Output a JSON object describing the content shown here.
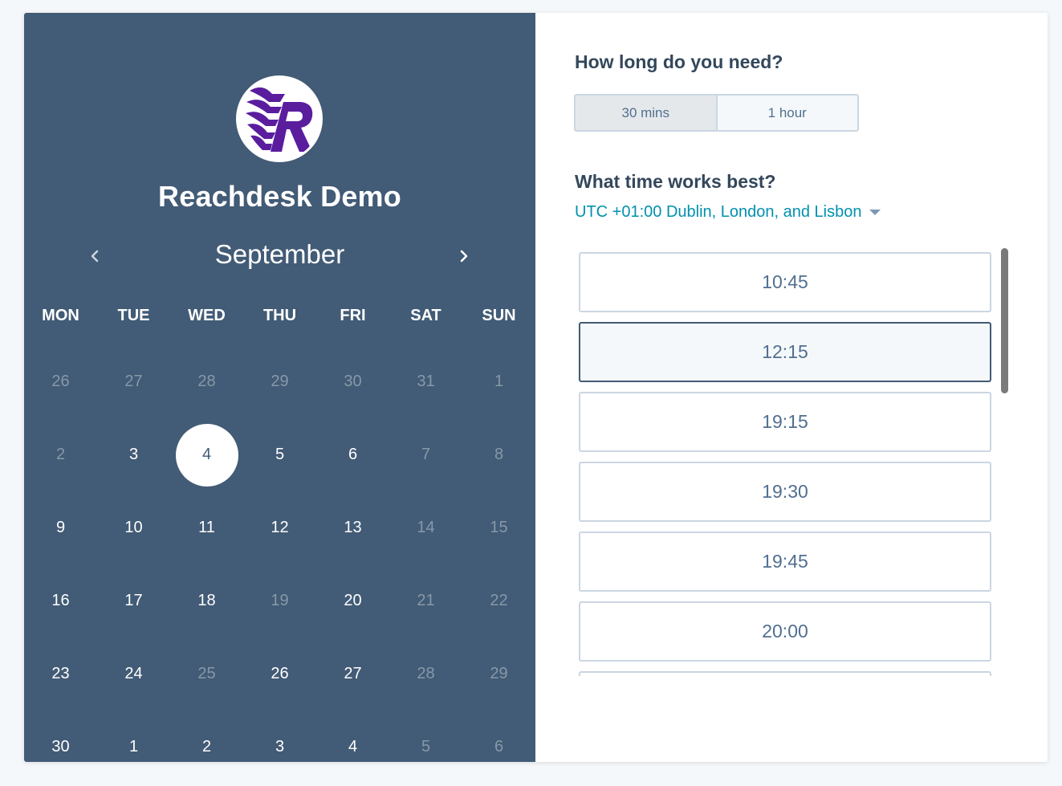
{
  "company": {
    "name": "Reachdesk Demo",
    "logo_letter": "R"
  },
  "calendar": {
    "month": "September",
    "weekdays": [
      "MON",
      "TUE",
      "WED",
      "THU",
      "FRI",
      "SAT",
      "SUN"
    ],
    "weeks": [
      [
        {
          "d": "26",
          "s": "disabled"
        },
        {
          "d": "27",
          "s": "disabled"
        },
        {
          "d": "28",
          "s": "disabled"
        },
        {
          "d": "29",
          "s": "disabled"
        },
        {
          "d": "30",
          "s": "disabled"
        },
        {
          "d": "31",
          "s": "disabled"
        },
        {
          "d": "1",
          "s": "disabled"
        }
      ],
      [
        {
          "d": "2",
          "s": "disabled"
        },
        {
          "d": "3",
          "s": "available"
        },
        {
          "d": "4",
          "s": "selected"
        },
        {
          "d": "5",
          "s": "available"
        },
        {
          "d": "6",
          "s": "available"
        },
        {
          "d": "7",
          "s": "disabled"
        },
        {
          "d": "8",
          "s": "disabled"
        }
      ],
      [
        {
          "d": "9",
          "s": "available"
        },
        {
          "d": "10",
          "s": "available"
        },
        {
          "d": "11",
          "s": "available"
        },
        {
          "d": "12",
          "s": "available"
        },
        {
          "d": "13",
          "s": "available"
        },
        {
          "d": "14",
          "s": "disabled"
        },
        {
          "d": "15",
          "s": "disabled"
        }
      ],
      [
        {
          "d": "16",
          "s": "available"
        },
        {
          "d": "17",
          "s": "available"
        },
        {
          "d": "18",
          "s": "available"
        },
        {
          "d": "19",
          "s": "disabled"
        },
        {
          "d": "20",
          "s": "available"
        },
        {
          "d": "21",
          "s": "disabled"
        },
        {
          "d": "22",
          "s": "disabled"
        }
      ],
      [
        {
          "d": "23",
          "s": "available"
        },
        {
          "d": "24",
          "s": "available"
        },
        {
          "d": "25",
          "s": "disabled"
        },
        {
          "d": "26",
          "s": "available"
        },
        {
          "d": "27",
          "s": "available"
        },
        {
          "d": "28",
          "s": "disabled"
        },
        {
          "d": "29",
          "s": "disabled"
        }
      ],
      [
        {
          "d": "30",
          "s": "available"
        },
        {
          "d": "1",
          "s": "available"
        },
        {
          "d": "2",
          "s": "available"
        },
        {
          "d": "3",
          "s": "available"
        },
        {
          "d": "4",
          "s": "available"
        },
        {
          "d": "5",
          "s": "disabled"
        },
        {
          "d": "6",
          "s": "disabled"
        }
      ]
    ]
  },
  "duration": {
    "question": "How long do you need?",
    "options": [
      "30 mins",
      "1 hour"
    ],
    "selected": "30 mins"
  },
  "time": {
    "question": "What time works best?",
    "timezone": "UTC +01:00 Dublin, London, and Lisbon",
    "slots": [
      "10:45",
      "12:15",
      "19:15",
      "19:30",
      "19:45",
      "20:00",
      ""
    ],
    "selected": "12:15"
  },
  "colors": {
    "panel": "#425b76",
    "accent_link": "#0091ae",
    "logo_purple": "#5a1d9e"
  }
}
